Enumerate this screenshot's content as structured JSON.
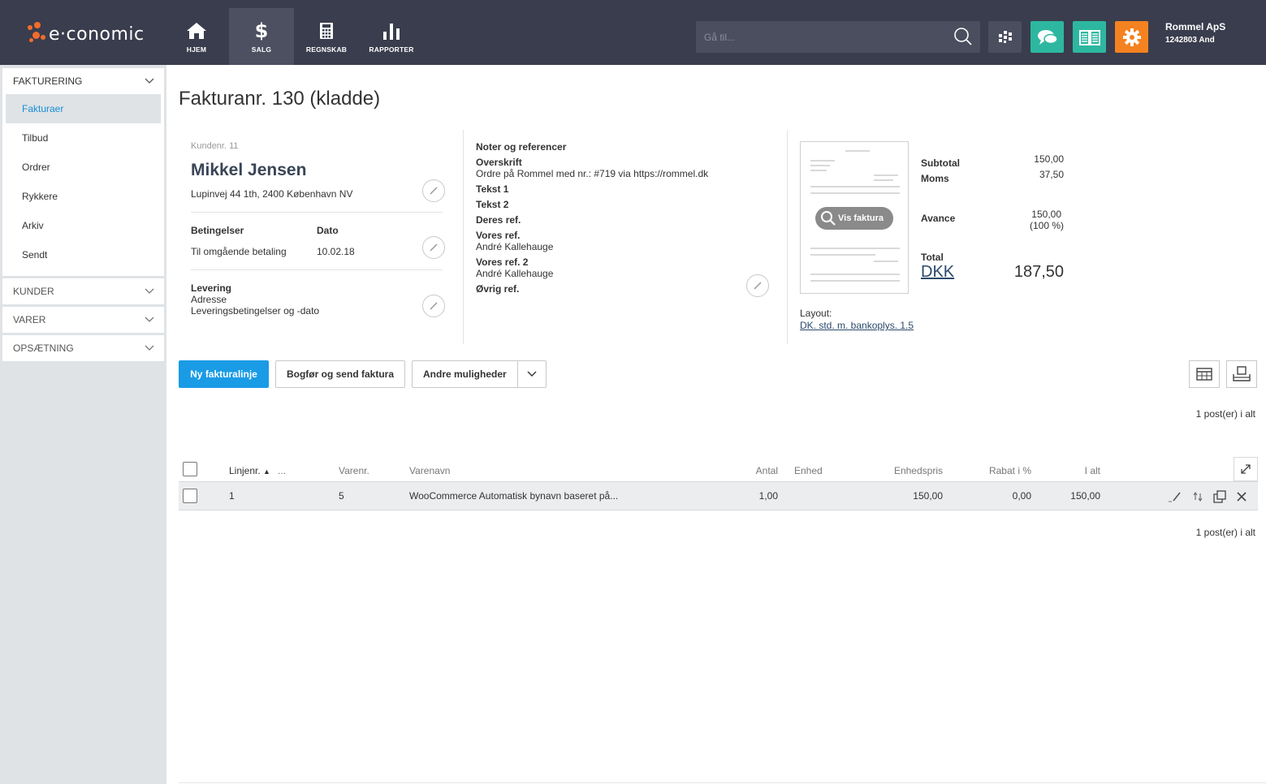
{
  "colors": {
    "topbar": "#3a3d4d",
    "nav_active": "#4c5061",
    "accent_blue": "#1a9be6",
    "logo_orange": "#f26c2b",
    "btn_apps": "#4a4e5e",
    "btn_chat": "#2db7a1",
    "btn_book": "#2db7a1",
    "btn_settings": "#f58220"
  },
  "header": {
    "logo_text": "e·conomic",
    "nav": [
      {
        "label": "HJEM",
        "icon": "home-icon"
      },
      {
        "label": "SALG",
        "icon": "dollar-icon"
      },
      {
        "label": "REGNSKAB",
        "icon": "calculator-icon"
      },
      {
        "label": "RAPPORTER",
        "icon": "bar-chart-icon"
      }
    ],
    "search_placeholder": "Gå til...",
    "account_name": "Rommel ApS",
    "account_sub": "1242803 And"
  },
  "sidebar": {
    "sections": [
      {
        "label": "FAKTURERING",
        "items": [
          "Fakturaer",
          "Tilbud",
          "Ordrer",
          "Rykkere",
          "Arkiv",
          "Sendt"
        ]
      },
      {
        "label": "KUNDER"
      },
      {
        "label": "VARER"
      },
      {
        "label": "OPSÆTNING"
      }
    ]
  },
  "page": {
    "title": "Fakturanr. 130 (kladde)"
  },
  "customer": {
    "number_label": "Kundenr. 11",
    "name": "Mikkel Jensen",
    "address": "Lupinvej 44 1th, 2400 København NV",
    "terms_label": "Betingelser",
    "terms_value": "Til omgående betaling",
    "date_label": "Dato",
    "date_value": "10.02.18",
    "delivery_label": "Levering",
    "delivery_address": "Adresse",
    "delivery_terms": "Leveringsbetingelser og -dato"
  },
  "notes": {
    "title": "Noter og referencer",
    "heading_label": "Overskrift",
    "heading_value": "Ordre på Rommel med nr.: #719 via https://rommel.dk",
    "text1_label": "Tekst 1",
    "text2_label": "Tekst 2",
    "their_ref_label": "Deres ref.",
    "our_ref_label": "Vores ref.",
    "our_ref_value": "André Kallehauge",
    "our_ref2_label": "Vores ref. 2",
    "our_ref2_value": "André Kallehauge",
    "other_ref_label": "Øvrig ref."
  },
  "preview": {
    "vis_label": "Vis faktura",
    "layout_label": "Layout:",
    "layout_value": "DK. std. m. bankoplys. 1.5"
  },
  "totals": {
    "subtotal_label": "Subtotal",
    "subtotal_value": "150,00",
    "moms_label": "Moms",
    "moms_value": "37,50",
    "avance_label": "Avance",
    "avance_value": "150,00",
    "avance_pct": "(100 %)",
    "total_label": "Total",
    "currency": "DKK",
    "total_value": "187,50"
  },
  "actions": {
    "new_line": "Ny fakturalinje",
    "book_send": "Bogfør og send faktura",
    "other": "Andre muligheder"
  },
  "table": {
    "count_text": "1 post(er) i alt",
    "headers": {
      "line": "Linjenr.",
      "more": "...",
      "item_no": "Varenr.",
      "item_name": "Varenavn",
      "qty": "Antal",
      "unit": "Enhed",
      "unit_price": "Enhedspris",
      "discount": "Rabat i %",
      "total": "I alt"
    },
    "rows": [
      {
        "line": "1",
        "item_no": "5",
        "item_name": "WooCommerce Automatisk bynavn baseret på...",
        "qty": "1,00",
        "unit": "",
        "unit_price": "150,00",
        "discount": "0,00",
        "total": "150,00"
      }
    ]
  }
}
